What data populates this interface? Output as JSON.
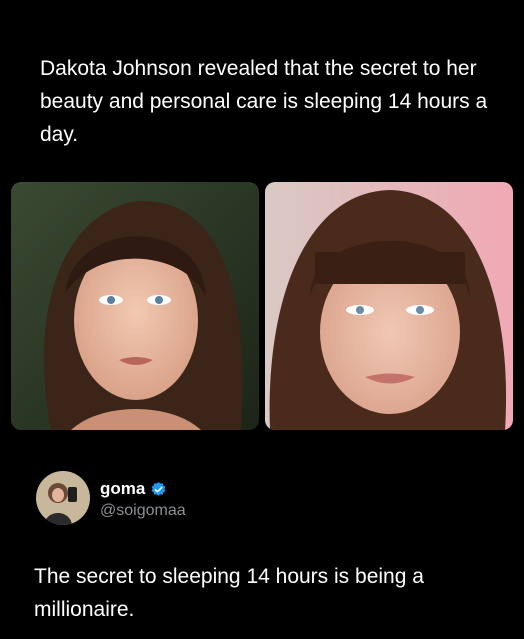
{
  "quote": {
    "text": "Dakota Johnson revealed that the secret to her beauty and personal care is sleeping 14 hours a day."
  },
  "photos": {
    "left": {
      "icon": "portrait-photo"
    },
    "right": {
      "icon": "portrait-photo"
    }
  },
  "author": {
    "name": "goma",
    "handle": "@soigomaa",
    "verified": true,
    "verified_color": "#1d9bf0",
    "avatar_icon": "profile-photo"
  },
  "tweet": {
    "text": "The secret to sleeping 14 hours is being a millionaire."
  },
  "colors": {
    "background": "#000000",
    "text": "#ffffff",
    "secondary_text": "#8b8f94"
  }
}
